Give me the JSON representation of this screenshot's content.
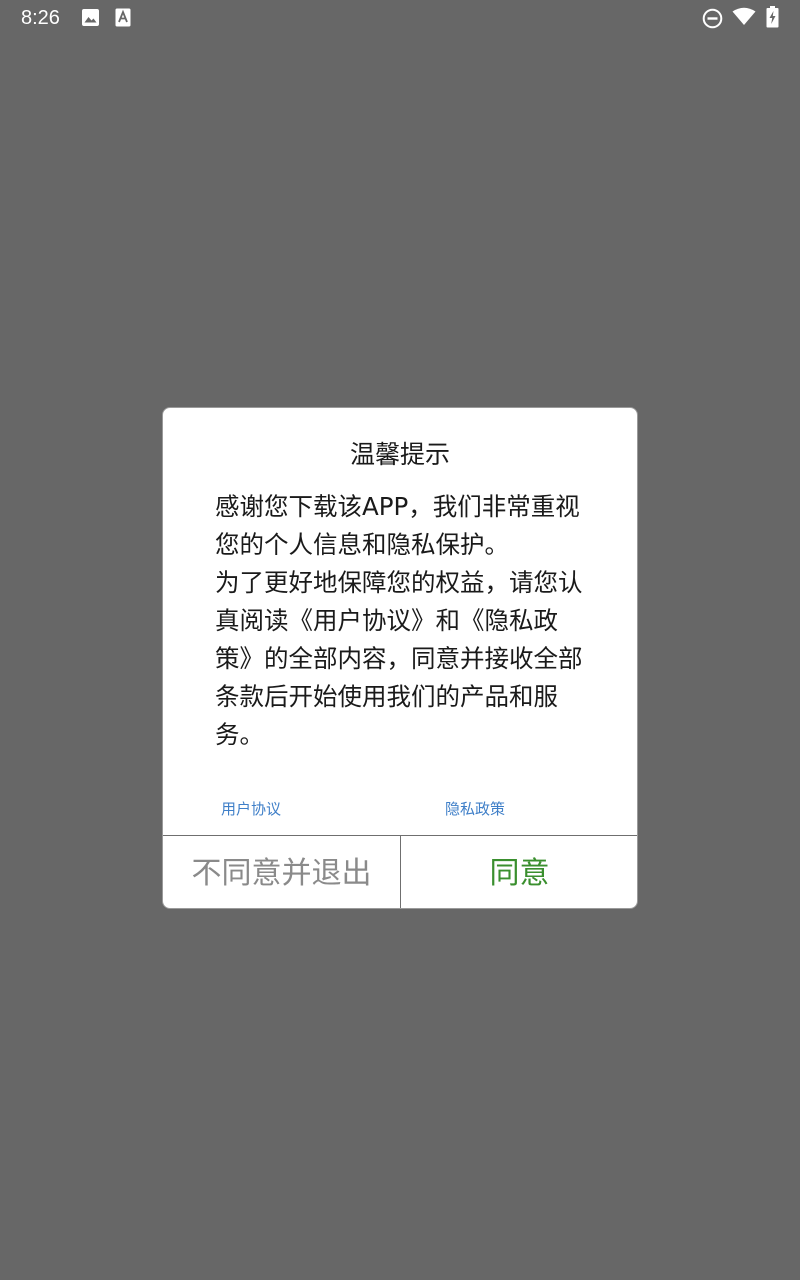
{
  "status_bar": {
    "time": "8:26",
    "left_icons": [
      "image-icon",
      "text-a-icon"
    ],
    "right_icons": [
      "do-not-disturb-icon",
      "wifi-icon",
      "battery-charging-icon"
    ]
  },
  "dialog": {
    "title": "温馨提示",
    "paragraph_1": "感谢您下载该APP，我们非常重视您的个人信息和隐私保护。",
    "paragraph_2": "为了更好地保障您的权益，请您认真阅读《用户协议》和《隐私政策》的全部内容，同意并接收全部条款后开始使用我们的产品和服务。",
    "link_agreement": "用户协议",
    "link_privacy": "隐私政策",
    "decline_label": "不同意并退出",
    "agree_label": "同意"
  },
  "colors": {
    "backdrop": "#676767",
    "link": "#3f7fc8",
    "agree": "#3a8f2e",
    "decline": "#8a8a8a"
  }
}
